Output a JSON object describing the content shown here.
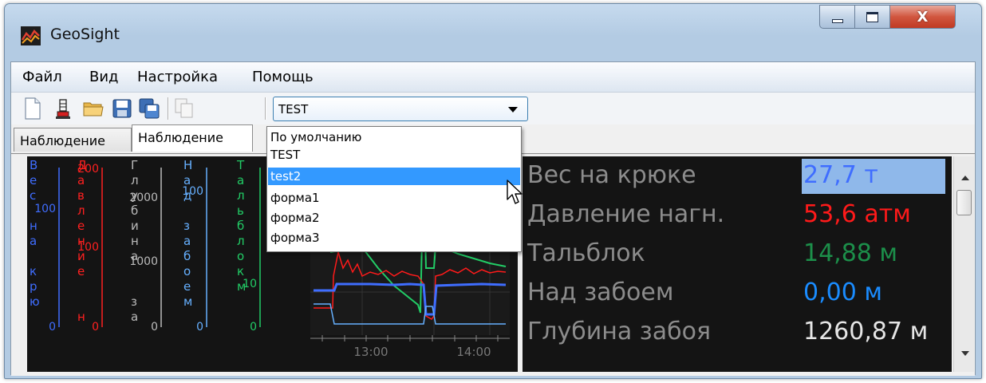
{
  "window": {
    "title": "GeoSight",
    "close_glyph": "X"
  },
  "menu": {
    "items": [
      "Файл",
      "Вид",
      "Настройка",
      "Помощь"
    ]
  },
  "toolbar": {
    "icons": [
      "new-document-icon",
      "lamp-icon",
      "open-folder-icon",
      "save-icon",
      "save-all-icon",
      "copy-icon-disabled"
    ],
    "profile_combo": {
      "value": "TEST",
      "options": [
        "По умолчанию",
        "TEST",
        "test2",
        "форма1",
        "форма2",
        "форма3"
      ],
      "highlighted": "test2"
    }
  },
  "tabs": [
    "Наблюдение",
    "Наблюдение"
  ],
  "chart": {
    "axis_labels": [
      "Вес на крюко",
      "Давление",
      "Глубина за",
      "Над забоем",
      "Тальблок"
    ],
    "time_labels": [
      "13:00",
      "14:00"
    ],
    "ticks": {
      "ves": [
        "100",
        "0"
      ],
      "davlenie": [
        "200",
        "100",
        "0"
      ],
      "glubina": [
        "2000",
        "1000",
        "0"
      ],
      "nad_zaboem": [
        "100",
        "0"
      ],
      "talblok": [
        "20",
        "10",
        "0"
      ]
    },
    "colors": {
      "ves": "#3f6dff",
      "davlenie": "#ff2020",
      "glubina": "#bbbbbb",
      "nad_zaboem": "#66b0ff",
      "talblok": "#22cc66"
    }
  },
  "readings": [
    {
      "label": "Вес на крюке",
      "value": "27,7 т",
      "color": "#3f6dff"
    },
    {
      "label": "Давление нагн.",
      "value": "53,6 атм",
      "color": "#ff1a1a"
    },
    {
      "label": "Тальблок",
      "value": "14,88 м",
      "color": "#1c8f4a"
    },
    {
      "label": "Над забоем",
      "value": "0,00 м",
      "color": "#1a8cff"
    },
    {
      "label": "Глубина забоя",
      "value": "1260,87 м",
      "color": "#e6e6e6"
    }
  ]
}
